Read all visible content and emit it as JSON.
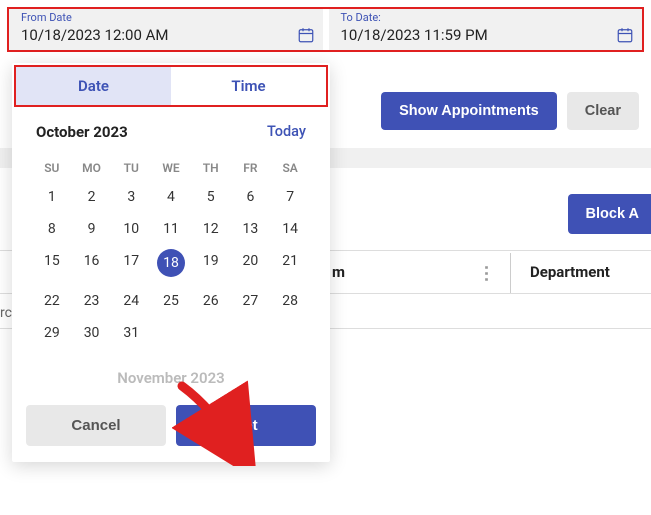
{
  "from": {
    "label": "From Date",
    "value": "10/18/2023 12:00 AM"
  },
  "to": {
    "label": "To Date:",
    "value": "10/18/2023 11:59 PM"
  },
  "actions": {
    "show": "Show Appointments",
    "clear": "Clear",
    "block": "Block A"
  },
  "table": {
    "col_m": "m",
    "col_dept": "Department",
    "rc": "rc"
  },
  "picker": {
    "tabs": {
      "date": "Date",
      "time": "Time"
    },
    "month": "October 2023",
    "today": "Today",
    "dow": [
      "SU",
      "MO",
      "TU",
      "WE",
      "TH",
      "FR",
      "SA"
    ],
    "weeks": [
      [
        "1",
        "2",
        "3",
        "4",
        "5",
        "6",
        "7"
      ],
      [
        "8",
        "9",
        "10",
        "11",
        "12",
        "13",
        "14"
      ],
      [
        "15",
        "16",
        "17",
        "18",
        "19",
        "20",
        "21"
      ],
      [
        "22",
        "23",
        "24",
        "25",
        "26",
        "27",
        "28"
      ],
      [
        "29",
        "30",
        "31",
        "",
        "",
        "",
        ""
      ]
    ],
    "selected_day": "18",
    "next_month": "November 2023",
    "cancel": "Cancel",
    "set": "Set"
  }
}
